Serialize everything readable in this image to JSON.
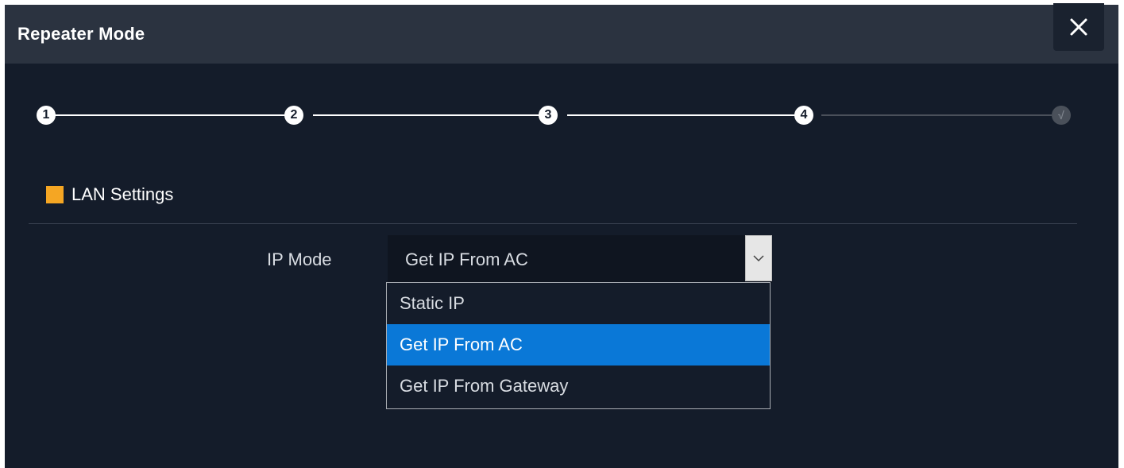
{
  "dialog": {
    "title": "Repeater Mode",
    "close_icon": "close-icon"
  },
  "stepper": {
    "steps": [
      {
        "label": "1",
        "state": "done"
      },
      {
        "label": "2",
        "state": "done"
      },
      {
        "label": "3",
        "state": "done"
      },
      {
        "label": "4",
        "state": "current"
      },
      {
        "label": "√",
        "state": "pending"
      }
    ]
  },
  "section": {
    "title": "LAN Settings",
    "accent_color": "#f5a623"
  },
  "ip_mode": {
    "label": "IP Mode",
    "value": "Get IP From AC",
    "options": [
      "Static IP",
      "Get IP From AC",
      "Get IP From Gateway"
    ],
    "selected_index": 1
  },
  "colors": {
    "background": "#141c2a",
    "header": "#2b3340",
    "selected_option": "#0a78d7"
  }
}
